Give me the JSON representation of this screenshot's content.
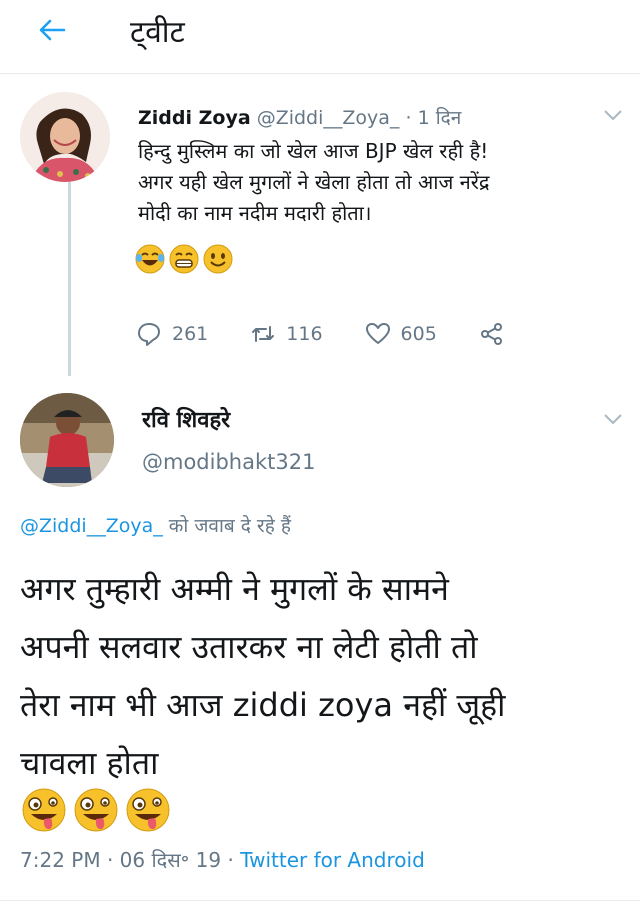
{
  "header": {
    "back_icon": "arrow-left-icon",
    "title": "ट्वीट"
  },
  "tweet": {
    "author_name": "Ziddi Zoya",
    "handle": "@Ziddi__Zoya_",
    "separator": " · ",
    "age": "1 दिन",
    "text_lines": [
      "हिन्दु मुस्लिम का जो खेल आज BJP खेल रही है!",
      "अगर यही खेल मुगलों ने खेला होता तो आज नरेंद्र",
      "मोदी का नाम नदीम मदारी होता।"
    ],
    "emojis": [
      "laughing-tears-emoji",
      "grinning-emoji",
      "smiling-emoji"
    ],
    "actions": {
      "replies": "261",
      "retweets": "116",
      "likes": "605"
    }
  },
  "reply": {
    "author_name": "रवि शिवहरे",
    "handle": "@modibhakt321",
    "replying_to_handle": "@Ziddi__Zoya_",
    "replying_to_suffix": " को जवाब दे रहे हैं",
    "text_lines": [
      "अगर तुम्हारी अम्मी ने मुगलों के सामने",
      "अपनी सलवार उतारकर ना लेटी होती तो",
      "तेरा नाम भी आज ziddi zoya नहीं जूही",
      "चावला होता"
    ],
    "emojis": [
      "zany-face-emoji",
      "zany-face-emoji",
      "zany-face-emoji"
    ],
    "timestamp": "7:22 PM · 06 दिस॰ 19 · ",
    "source_app": "Twitter for Android"
  },
  "colors": {
    "link_blue": "#1b95e0",
    "secondary_gray": "#657786",
    "border_gray": "#e6ecf0"
  }
}
